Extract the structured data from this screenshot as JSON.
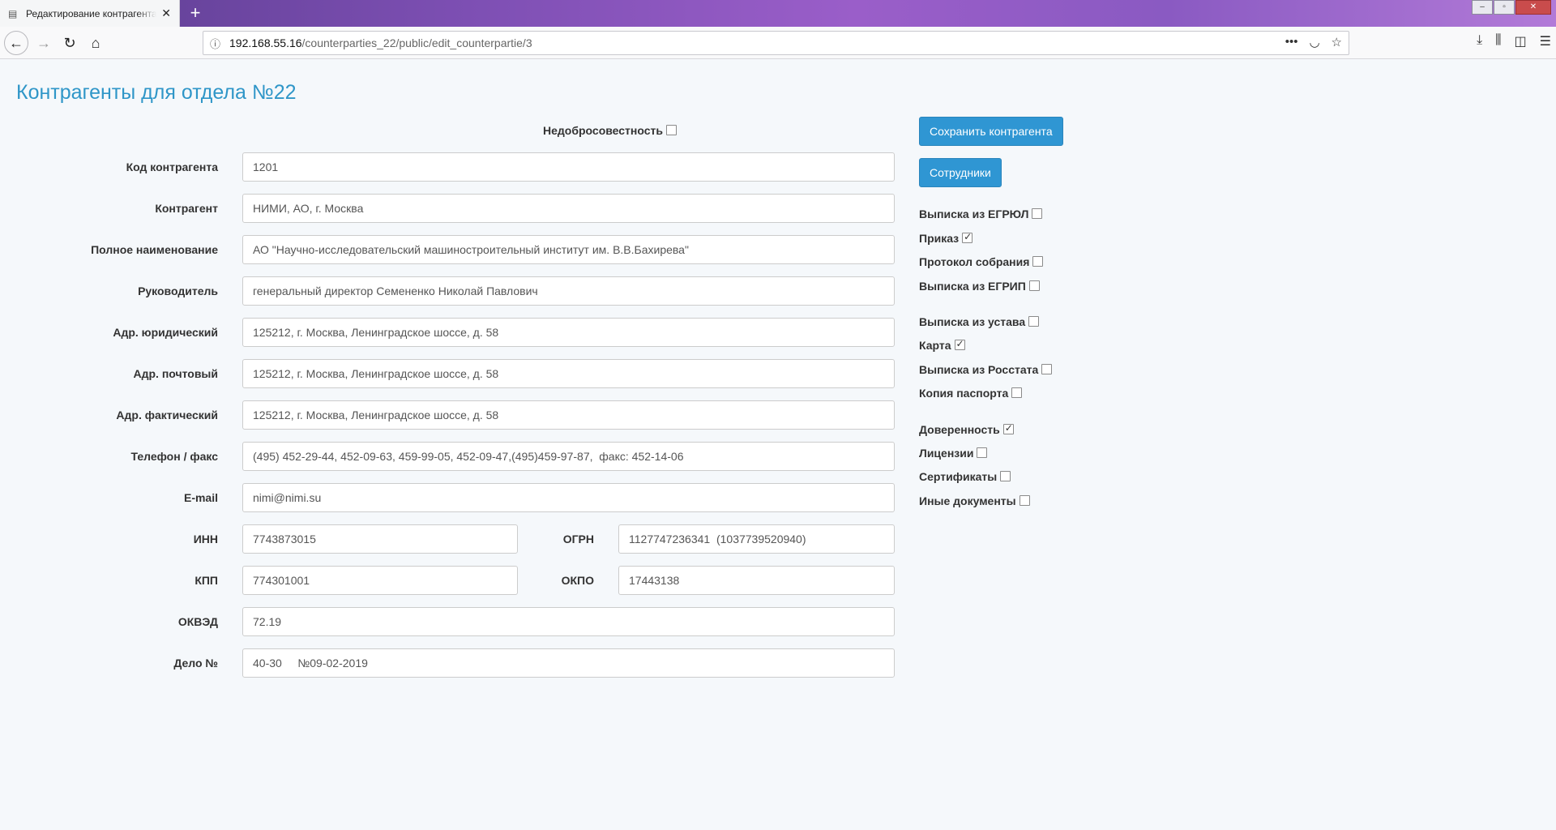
{
  "browser": {
    "tab_title": "Редактирование контрагента",
    "url_host": "192.168.55.16",
    "url_path": "/counterparties_22/public/edit_counterpartie/3"
  },
  "page": {
    "title": "Контрагенты для отдела №22"
  },
  "dishonesty": {
    "label": "Недобросовестность",
    "checked": false
  },
  "fields": {
    "code": {
      "label": "Код контрагента",
      "value": "1201"
    },
    "name": {
      "label": "Контрагент",
      "value": "НИМИ, АО, г. Москва"
    },
    "full_name": {
      "label": "Полное наименование",
      "value": "АО \"Научно-исследовательский машиностроительный институт им. В.В.Бахирева\""
    },
    "head": {
      "label": "Руководитель",
      "value": "генеральный директор Семененко Николай Павлович"
    },
    "addr_legal": {
      "label": "Адр. юридический",
      "value": "125212, г. Москва, Ленинградское шоссе, д. 58"
    },
    "addr_post": {
      "label": "Адр. почтовый",
      "value": "125212, г. Москва, Ленинградское шоссе, д. 58"
    },
    "addr_fact": {
      "label": "Адр. фактический",
      "value": "125212, г. Москва, Ленинградское шоссе, д. 58"
    },
    "phone": {
      "label": "Телефон / факс",
      "value": "(495) 452-29-44, 452-09-63, 459-99-05, 452-09-47,(495)459-97-87,  факс: 452-14-06"
    },
    "email": {
      "label": "E-mail",
      "value": "nimi@nimi.su"
    },
    "inn": {
      "label": "ИНН",
      "value": "7743873015"
    },
    "ogrn": {
      "label": "ОГРН",
      "value": "1127747236341  (1037739520940)"
    },
    "kpp": {
      "label": "КПП",
      "value": "774301001"
    },
    "okpo": {
      "label": "ОКПО",
      "value": "17443138"
    },
    "okved": {
      "label": "ОКВЭД",
      "value": "72.19"
    },
    "case": {
      "label": "Дело №",
      "value": "40-30     №09-02-2019"
    }
  },
  "buttons": {
    "save": "Сохранить контрагента",
    "employees": "Сотрудники"
  },
  "documents": [
    {
      "label": "Выписка из ЕГРЮЛ",
      "checked": false
    },
    {
      "label": "Приказ",
      "checked": true
    },
    {
      "label": "Протокол собрания",
      "checked": false
    },
    {
      "label": "Выписка из ЕГРИП",
      "checked": false
    },
    {
      "label": "Выписка из устава",
      "checked": false
    },
    {
      "label": "Карта",
      "checked": true
    },
    {
      "label": "Выписка из Росстата",
      "checked": false
    },
    {
      "label": "Копия паспорта",
      "checked": false
    },
    {
      "label": "Доверенность",
      "checked": true
    },
    {
      "label": "Лицензии",
      "checked": false
    },
    {
      "label": "Сертификаты",
      "checked": false
    },
    {
      "label": "Иные документы",
      "checked": false
    }
  ],
  "icons": {
    "back": "arrow-left-icon",
    "forward": "arrow-right-icon",
    "reload": "reload-icon",
    "home": "home-icon",
    "info": "info-icon",
    "more": "more-icon",
    "pocket": "pocket-icon",
    "bookmark": "star-icon",
    "download": "download-icon",
    "library": "library-icon",
    "sidebar": "sidebar-icon",
    "menu": "menu-icon"
  },
  "colors": {
    "title": "#2f96c8",
    "button": "#2f96d3",
    "background": "#f5f8fb"
  }
}
